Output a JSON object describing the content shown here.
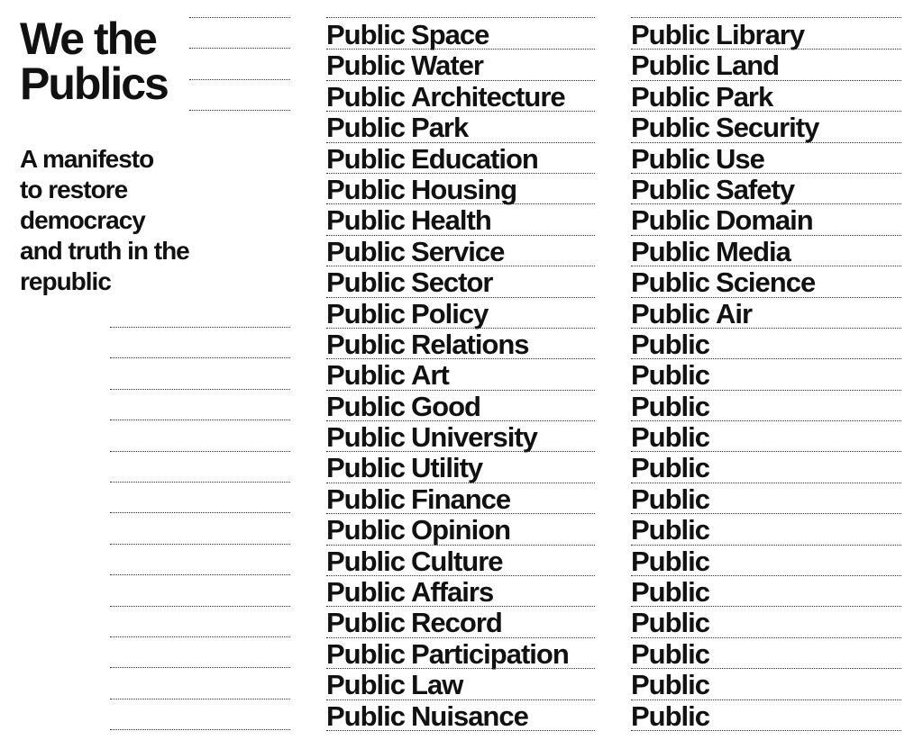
{
  "header": {
    "title_line1": "We the",
    "title_line2": "Publics",
    "subtitle_lines": [
      "A manifesto",
      "to restore",
      "democracy",
      "and truth in the",
      "republic"
    ]
  },
  "prefix": "Public",
  "column1": [
    "Space",
    "Water",
    "Architecture",
    "Park",
    "Education",
    "Housing",
    "Health",
    "Service",
    "Sector",
    "Policy",
    "Relations",
    "Art",
    "Good",
    "University",
    "Utility",
    "Finance",
    "Opinion",
    "Culture",
    "Affairs",
    "Record",
    "Participation",
    "Law",
    "Nuisance"
  ],
  "column2": [
    "Library",
    "Land",
    "Park",
    "Security",
    "Use",
    "Safety",
    "Domain",
    "Media",
    "Science",
    "Air",
    "",
    "",
    "",
    "",
    "",
    "",
    "",
    "",
    "",
    "",
    "",
    "",
    ""
  ]
}
